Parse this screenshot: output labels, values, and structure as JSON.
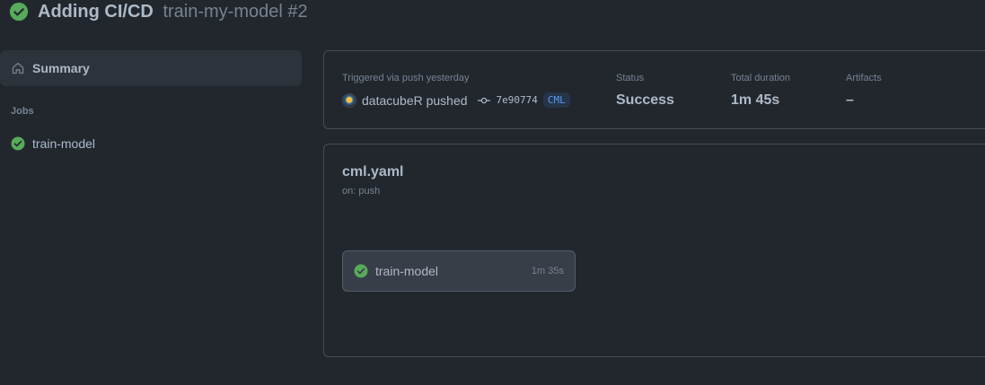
{
  "header": {
    "workflow_name": "Adding CI/CD",
    "run_name": "train-my-model #2",
    "status_icon": "check-circle-fill-icon"
  },
  "sidebar": {
    "summary_label": "Summary",
    "summary_icon": "home-icon",
    "jobs_heading": "Jobs",
    "jobs": [
      {
        "label": "train-model",
        "status_icon": "check-circle-fill-icon"
      }
    ]
  },
  "summary": {
    "trigger_label": "Triggered via push yesterday",
    "actor": "datacubeR pushed",
    "commit_sha": "7e90774",
    "branch": "CML",
    "status_label": "Status",
    "status_value": "Success",
    "duration_label": "Total duration",
    "duration_value": "1m 45s",
    "artifacts_label": "Artifacts",
    "artifacts_value": "–"
  },
  "graph": {
    "file": "cml.yaml",
    "trigger": "on: push",
    "jobs": [
      {
        "name": "train-model",
        "duration": "1m 35s",
        "status_icon": "check-circle-fill-icon"
      }
    ]
  },
  "colors": {
    "background": "#22272e",
    "success": "#57ab5a",
    "text": "#adbac7",
    "muted": "#768390",
    "border": "#444c56",
    "branch_accent": "#539bf5"
  }
}
